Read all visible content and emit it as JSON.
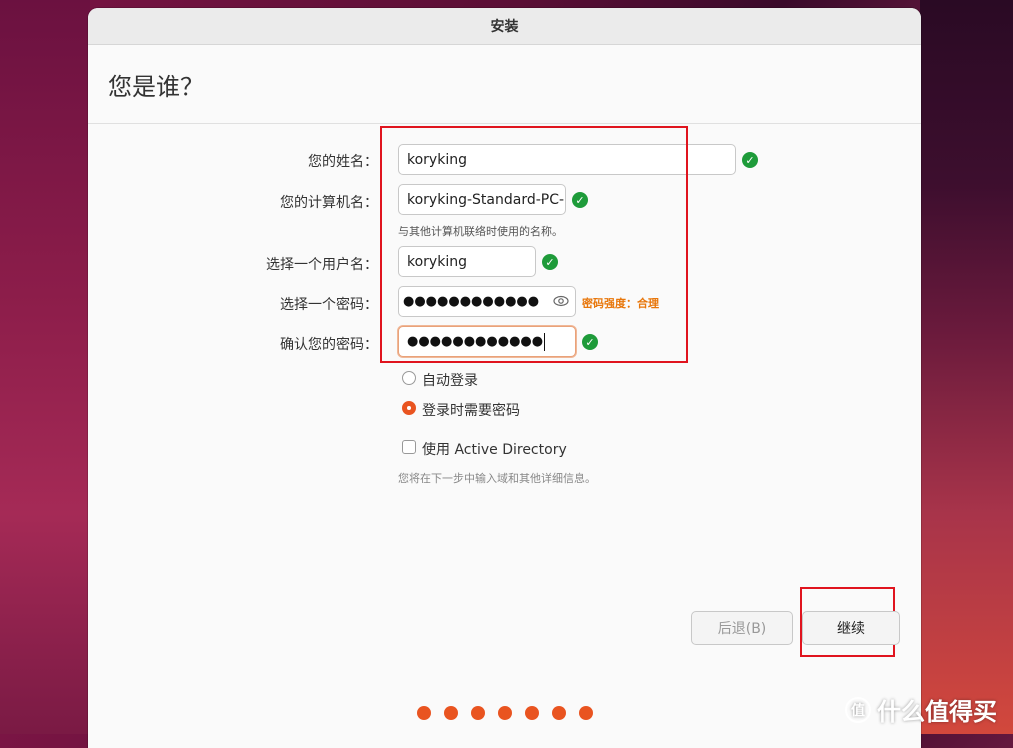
{
  "window": {
    "title": "安装"
  },
  "page": {
    "heading": "您是谁？"
  },
  "form": {
    "name_label": "您的姓名：",
    "name_value": "koryking",
    "computer_label": "您的计算机名：",
    "computer_value": "koryking-Standard-PC-",
    "computer_hint": "与其他计算机联络时使用的名称。",
    "username_label": "选择一个用户名：",
    "username_value": "koryking",
    "password_label": "选择一个密码：",
    "password_value": "●●●●●●●●●●●●",
    "password_strength": "密码强度：合理",
    "confirm_label": "确认您的密码：",
    "confirm_value": "●●●●●●●●●●●●"
  },
  "login": {
    "auto_login": "自动登录",
    "require_password": "登录时需要密码",
    "selected": "require_password"
  },
  "active_directory": {
    "label": "使用 Active Directory",
    "checked": false,
    "hint": "您将在下一步中输入域和其他详细信息。"
  },
  "buttons": {
    "back": "后退(B)",
    "continue": "继续"
  },
  "steps": {
    "total": 7,
    "color": "#e95420"
  },
  "colors": {
    "accent": "#e95420",
    "valid": "#1e9b3a",
    "annotation": "#e0141e",
    "strength": "#e8760a"
  },
  "icons": {
    "check": "check-icon",
    "eye": "eye-icon"
  },
  "watermark": {
    "text": "什么值得买",
    "symbol": "值"
  }
}
